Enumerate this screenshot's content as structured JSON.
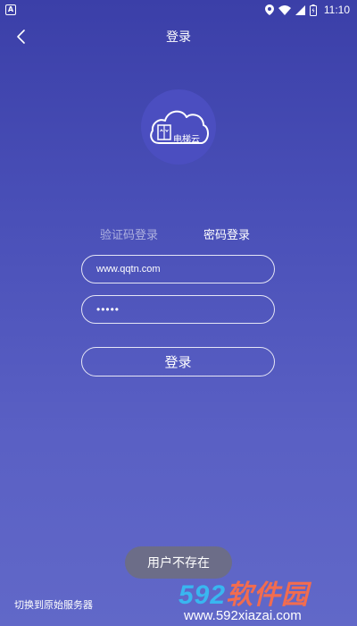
{
  "status_bar": {
    "app_indicator": "A",
    "time": "11:10",
    "icons": [
      "location-icon",
      "wifi-icon",
      "signal-icon",
      "battery-icon"
    ]
  },
  "header": {
    "title": "登录",
    "back_icon": "chevron-left-icon"
  },
  "logo": {
    "text": "电梯云",
    "icon": "cloud-elevator-icon"
  },
  "tabs": [
    {
      "label": "验证码登录",
      "active": false
    },
    {
      "label": "密码登录",
      "active": true
    }
  ],
  "form": {
    "username_value": "www.qqtn.com",
    "password_value": "•••••",
    "login_label": "登录"
  },
  "toast": {
    "text": "用户不存在"
  },
  "footer": {
    "switch_server_label": "切换到原始服务器"
  },
  "watermark": {
    "brand_number": "592",
    "brand_text": "软件园",
    "url": "www.592xiazai.com"
  },
  "colors": {
    "background_top": "#3b3fa8",
    "background_bottom": "#6168c8",
    "logo_circle": "#4b4ec0",
    "watermark_blue": "#39b6f0",
    "watermark_orange": "#f26c4f"
  }
}
